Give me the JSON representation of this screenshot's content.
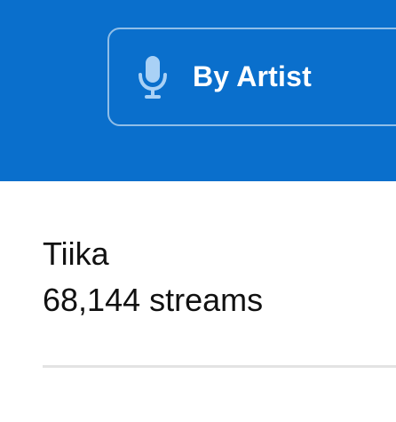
{
  "header": {
    "accent_color": "#0a6fcc",
    "filter_button": {
      "label": "By Artist",
      "icon": "microphone-icon"
    }
  },
  "artist": {
    "name": "Tiika",
    "streams": "68,144 streams"
  }
}
